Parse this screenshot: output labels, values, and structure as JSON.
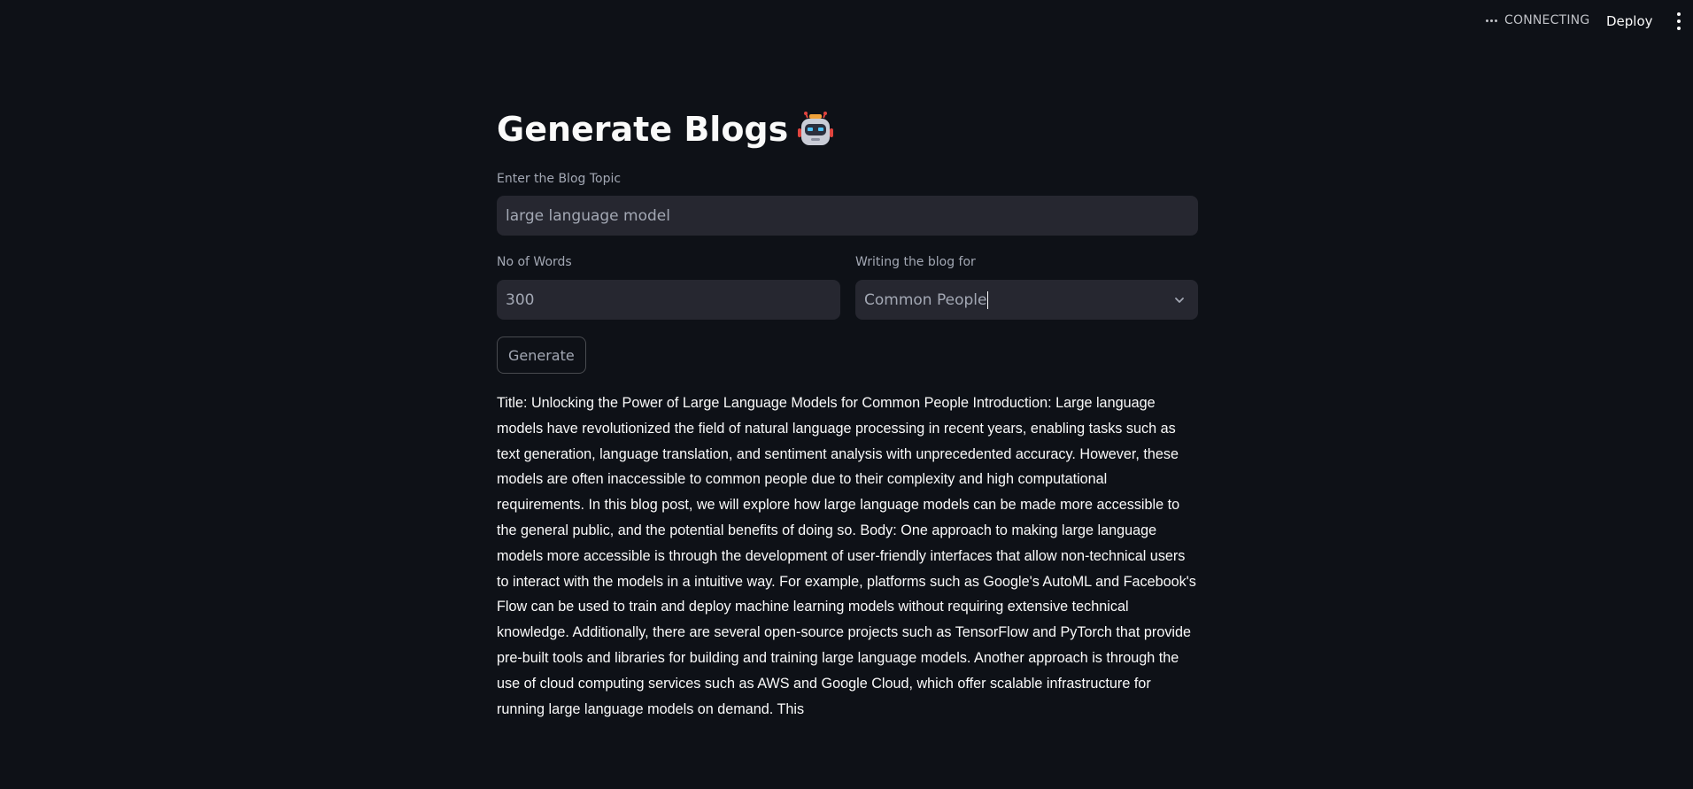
{
  "toolbar": {
    "status": "CONNECTING",
    "deploy_label": "Deploy"
  },
  "main": {
    "title": "Generate Blogs",
    "title_emoji": "robot-icon",
    "topic_label": "Enter the Blog Topic",
    "topic_value": "large language model",
    "words_label": "No of Words",
    "words_value": "300",
    "audience_label": "Writing the blog for",
    "audience_value": "Common People",
    "generate_label": "Generate",
    "output_text": "Title: Unlocking the Power of Large Language Models for Common People Introduction: Large language models have revolutionized the field of natural language processing in recent years, enabling tasks such as text generation, language translation, and sentiment analysis with unprecedented accuracy. However, these models are often inaccessible to common people due to their complexity and high computational requirements. In this blog post, we will explore how large language models can be made more accessible to the general public, and the potential benefits of doing so. Body: One approach to making large language models more accessible is through the development of user-friendly interfaces that allow non-technical users to interact with the models in a intuitive way. For example, platforms such as Google's AutoML and Facebook's Flow can be used to train and deploy machine learning models without requiring extensive technical knowledge. Additionally, there are several open-source projects such as TensorFlow and PyTorch that provide pre-built tools and libraries for building and training large language models. Another approach is through the use of cloud computing services such as AWS and Google Cloud, which offer scalable infrastructure for running large language models on demand. This"
  },
  "colors": {
    "background": "#0e1117",
    "input_bg": "#262730",
    "text": "#fafafa",
    "muted": "#a3a8b4"
  }
}
